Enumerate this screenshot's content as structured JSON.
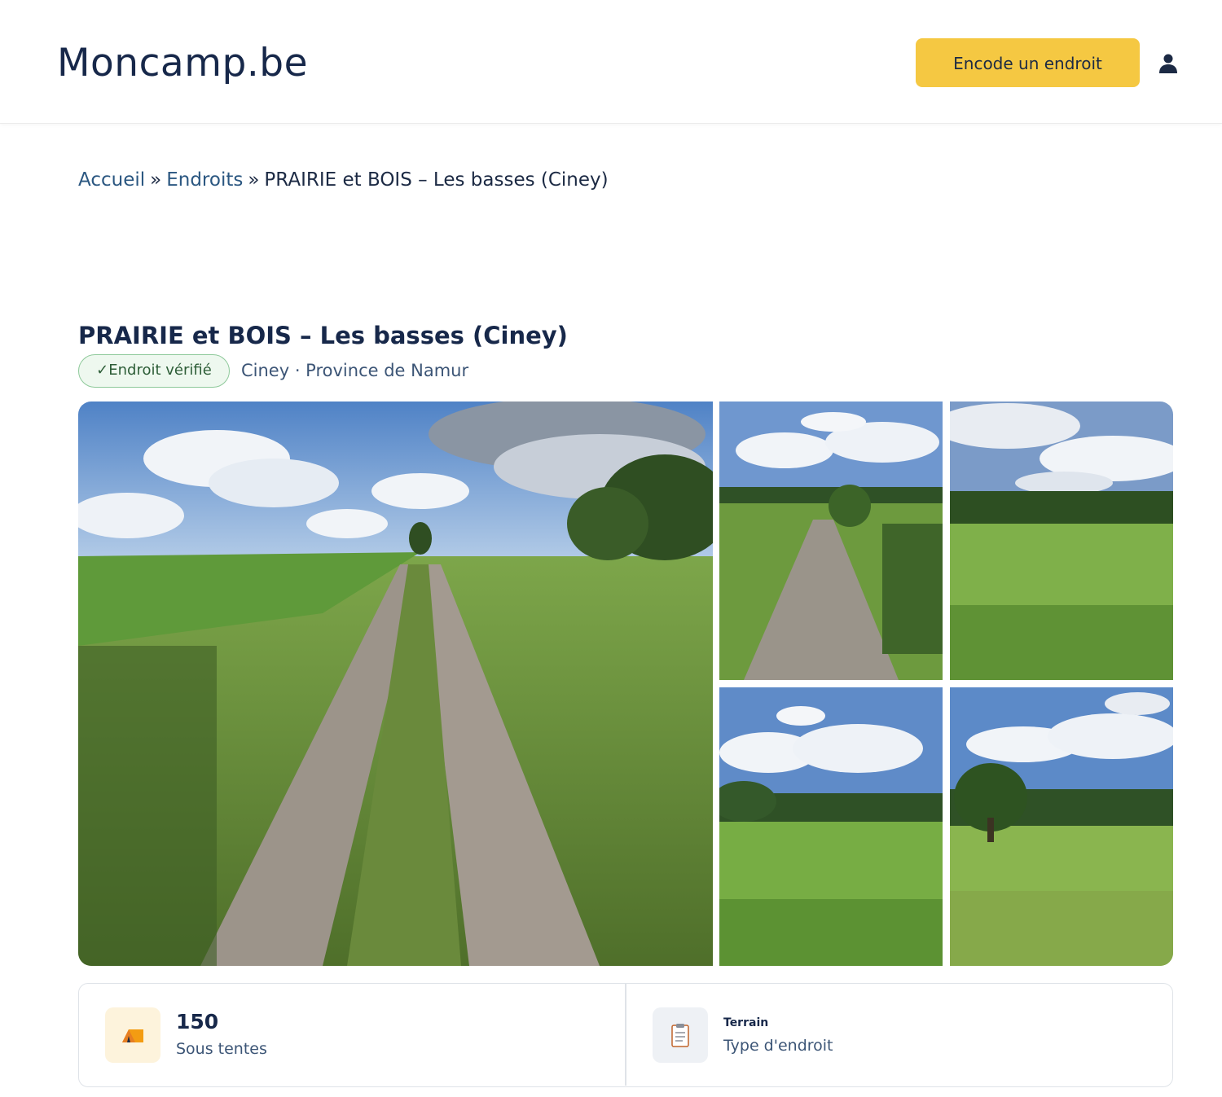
{
  "header": {
    "logo": "Moncamp.be",
    "cta_label": "Encode un endroit",
    "user_icon": "user-icon"
  },
  "breadcrumb": {
    "home": "Accueil",
    "section": "Endroits",
    "current": "PRAIRIE et BOIS – Les basses (Ciney)",
    "separator": "»"
  },
  "place": {
    "title": "PRAIRIE et BOIS – Les basses (Ciney)",
    "verified_label": "✓Endroit vérifié",
    "location": "Ciney · Province de Namur"
  },
  "gallery": {
    "photos": [
      "dirt-road-meadow-photo",
      "gravel-path-photo",
      "grass-field-woods-photo",
      "open-meadow-photo",
      "oak-tree-meadow-photo"
    ]
  },
  "info": {
    "capacity": {
      "value": "150",
      "label": "Sous tentes",
      "icon": "tent-icon"
    },
    "type": {
      "value": "Terrain",
      "label": "Type d'endroit",
      "icon": "clipboard-icon"
    }
  },
  "colors": {
    "accent": "#f5c842",
    "brand": "#17284a",
    "link": "#2b5781",
    "verified_border": "#8ec99a"
  }
}
